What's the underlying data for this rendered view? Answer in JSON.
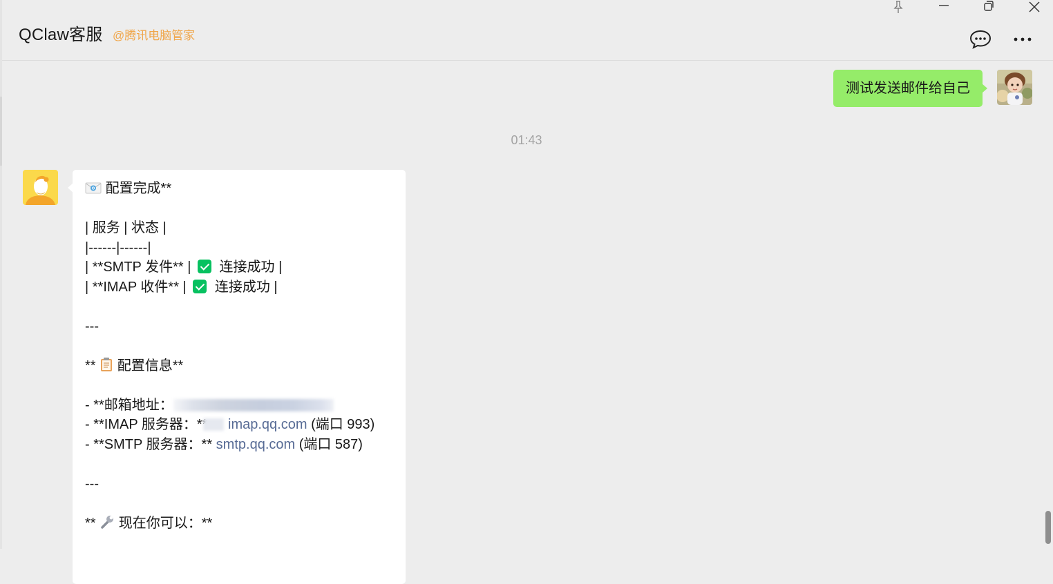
{
  "window": {
    "title": "QClaw客服",
    "subtitle": "@腾讯电脑管家",
    "controls": [
      "pin-icon",
      "minimize-icon",
      "restore-icon",
      "close-icon"
    ],
    "header_actions": [
      "chat-bubble-icon",
      "more-icon"
    ]
  },
  "messages": {
    "outgoing": {
      "text": "测试发送邮件给自己",
      "color": "#95ec69"
    },
    "timestamp": "01:43",
    "incoming": {
      "line1": "配置完成**",
      "table_header": "| 服务 | 状态 |",
      "table_sep": "|------|------|",
      "row1_a": "| **SMTP 发件** |",
      "row1_b": "连接成功 |",
      "row2_a": "| **IMAP 收件** |",
      "row2_b": "连接成功 |",
      "hr1": "---",
      "section1_a": "**",
      "section1_b": "配置信息**",
      "email_label": "- **邮箱地址：",
      "imap_label": "- **IMAP 服务器：**",
      "imap_host": "imap.qq.com",
      "imap_port": "(端口 993)",
      "smtp_label": "- **SMTP 服务器：**",
      "smtp_host": "smtp.qq.com",
      "smtp_port": "(端口 587)",
      "hr2": "---",
      "section2_a": "**",
      "section2_b": "现在你可以：**"
    }
  },
  "colors": {
    "link": "#576b95",
    "subtitle": "#f0a64a",
    "check": "#07c160",
    "background": "#ededed"
  }
}
